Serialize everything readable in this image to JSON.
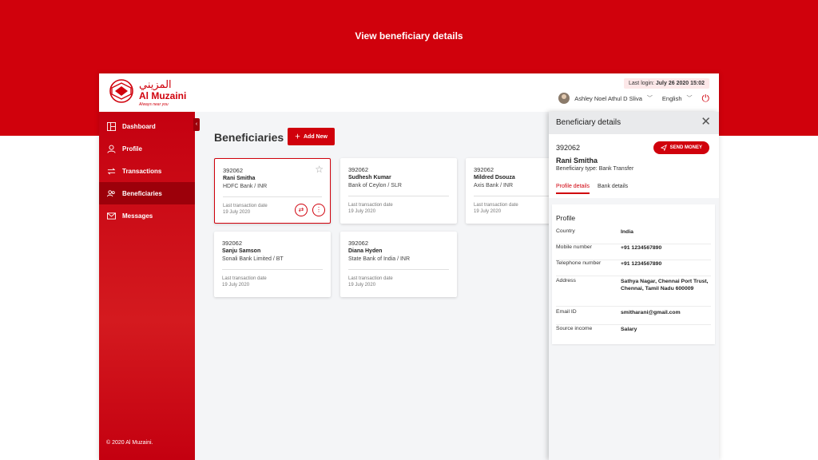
{
  "caption": "View beneficiary details",
  "brand": {
    "name": "Al Muzaini",
    "arabic": "المزيني",
    "tagline": "Always near you",
    "color": "#d0010c"
  },
  "header": {
    "last_login_label": "Last login:",
    "last_login_value": "July 26 2020 15:02",
    "user_name": "Ashley Noel Athul D Sliva",
    "language": "English"
  },
  "sidebar": {
    "items": [
      {
        "label": "Dashboard",
        "icon": "dashboard-icon"
      },
      {
        "label": "Profile",
        "icon": "user-icon"
      },
      {
        "label": "Transactions",
        "icon": "transfer-icon"
      },
      {
        "label": "Beneficiaries",
        "icon": "beneficiaries-icon"
      },
      {
        "label": "Messages",
        "icon": "mail-icon"
      }
    ],
    "copyright": "© 2020 Al Muzaini."
  },
  "main": {
    "title": "Beneficiaries",
    "add_label": "Add New",
    "last_tx_label": "Last transaction date",
    "cards": [
      {
        "id": "392062",
        "name": "Rani Smitha",
        "bank": "HDFC Bank / INR",
        "date": "19 July 2020"
      },
      {
        "id": "392062",
        "name": "Sudhesh Kumar",
        "bank": "Bank of Ceylon / SLR",
        "date": "19 July 2020"
      },
      {
        "id": "392062",
        "name": "Mildred Dsouza",
        "bank": "Axis Bank  / INR",
        "date": "19 July 2020"
      },
      {
        "id": "392062",
        "name": "Sanju Samson",
        "bank": "Sonali Bank Limited  / BT",
        "date": "19 July 2020"
      },
      {
        "id": "392062",
        "name": "Diana Hyden",
        "bank": "State Bank of India / INR",
        "date": "19 July 2020"
      }
    ]
  },
  "panel": {
    "title": "Beneficiary details",
    "id": "392062",
    "name": "Rani Smitha",
    "type": "Beneficiary type: Bank Transfer",
    "send_label": "SEND MONEY",
    "tabs": [
      "Profile details",
      "Bank details"
    ],
    "profile_title": "Profile",
    "rows": [
      {
        "key": "Country",
        "value": "India"
      },
      {
        "key": "Mobile number",
        "value": "+91 1234567890"
      },
      {
        "key": "Telephone number",
        "value": "+91 1234567890"
      },
      {
        "key": "Address",
        "value": "Sathya Nagar, Chennai Port Trust, Chennai, Tamil Nadu 600009"
      },
      {
        "key": "Email ID",
        "value": "smitharani@gmail.com"
      },
      {
        "key": "Source income",
        "value": "Salary"
      }
    ]
  }
}
